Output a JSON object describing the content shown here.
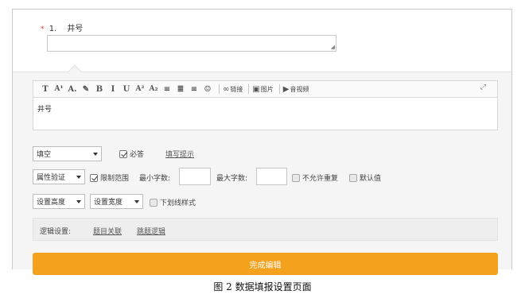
{
  "question": {
    "required_mark": "*",
    "number": "1.",
    "title": "井号"
  },
  "toolbar": {
    "items": [
      {
        "icon": "text-style-icon",
        "glyph": "T"
      },
      {
        "icon": "font-size-icon",
        "glyph": "A¹"
      },
      {
        "icon": "font-color-icon",
        "glyph": "A."
      },
      {
        "icon": "background-color-icon",
        "glyph": "✎"
      },
      {
        "icon": "bold-icon",
        "glyph": "B"
      },
      {
        "icon": "italic-icon",
        "glyph": "I"
      },
      {
        "icon": "underline-icon",
        "glyph": "U"
      },
      {
        "icon": "superscript-icon",
        "glyph": "A²"
      },
      {
        "icon": "subscript-icon",
        "glyph": "A₂"
      },
      {
        "icon": "align-left-icon",
        "glyph": "≡"
      },
      {
        "icon": "align-center-icon",
        "glyph": "≣"
      },
      {
        "icon": "align-right-icon",
        "glyph": "≡"
      },
      {
        "icon": "emoji-icon",
        "glyph": "☺"
      }
    ],
    "link_label": "链接",
    "image_label": "图片",
    "media_label": "音视频",
    "fullscreen_glyph": "⤢"
  },
  "editor": {
    "content": "井号"
  },
  "row1": {
    "type_select": "填空",
    "required_label": "必答",
    "required_checked": true,
    "hint_link": "填写提示"
  },
  "row2": {
    "validate_select": "属性验证",
    "limit_label": "限制范围",
    "limit_checked": true,
    "min_label": "最小字数:",
    "min_value": "",
    "max_label": "最大字数:",
    "max_value": "",
    "no_repeat_label": "不允许重复",
    "no_repeat_checked": false,
    "default_label": "默认值",
    "default_checked": false
  },
  "row3": {
    "height_select": "设置高度",
    "width_select": "设置宽度",
    "underline_label": "下划线样式",
    "underline_checked": false
  },
  "logic": {
    "title": "逻辑设置:",
    "link1": "题目关联",
    "link2": "跳题逻辑"
  },
  "done_button": "完成编辑",
  "caption": "图 2  数据填报设置页面",
  "colors": {
    "accent": "#f4a21e",
    "required": "#e33333"
  }
}
